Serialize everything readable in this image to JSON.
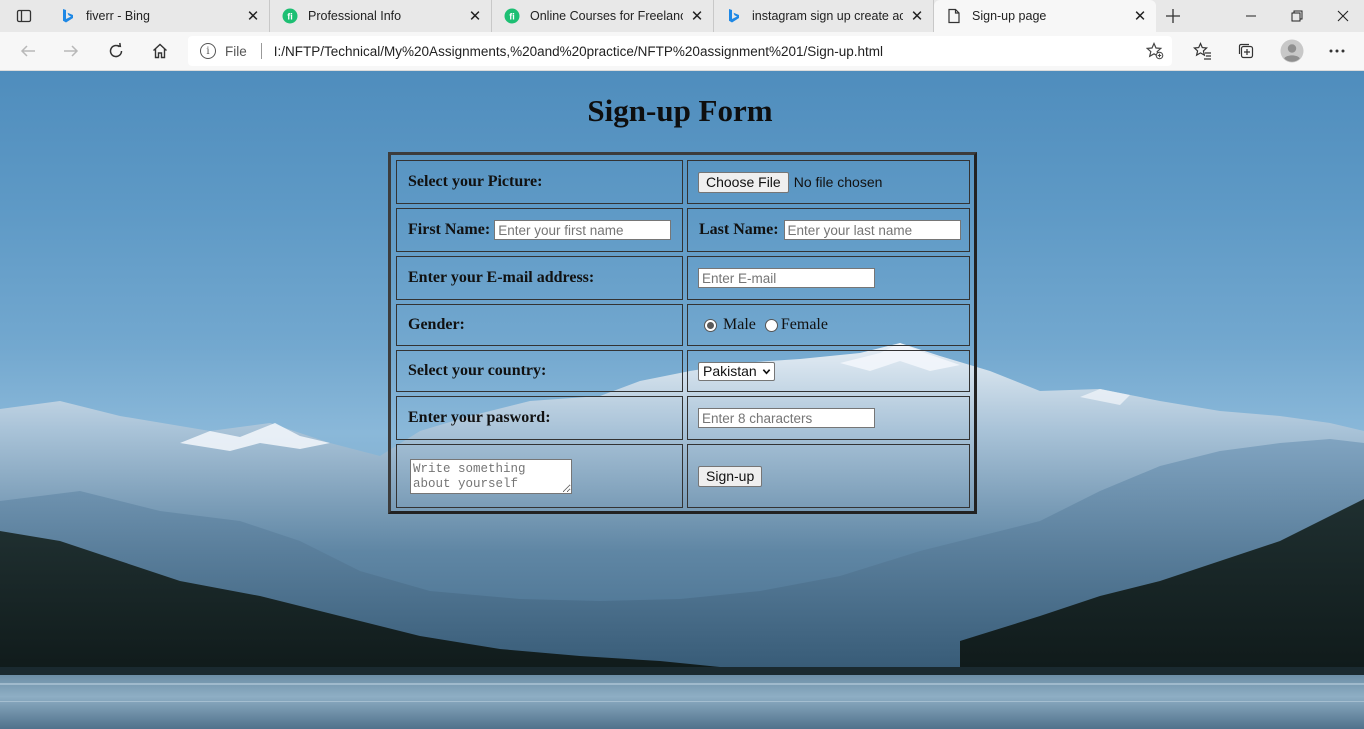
{
  "browser": {
    "tabs": [
      {
        "title": "fiverr - Bing",
        "icon": "bing-icon",
        "active": false
      },
      {
        "title": "Professional Info",
        "icon": "fiverr-learn-icon",
        "active": false
      },
      {
        "title": "Online Courses for Freelancers",
        "icon": "fiverr-learn-icon",
        "active": false
      },
      {
        "title": "instagram sign up create account",
        "icon": "bing-icon",
        "active": false
      },
      {
        "title": "Sign-up page",
        "icon": "page-icon",
        "active": true
      }
    ],
    "address": {
      "scheme_label": "File",
      "url": "I:/NFTP/Technical/My%20Assignments,%20and%20practice/NFTP%20assignment%201/Sign-up.html"
    },
    "colors": {
      "accent": "#1da1f2",
      "fiverr_green": "#1dbf73",
      "bing_blue": "#1e88e5"
    }
  },
  "page": {
    "title": "Sign-up Form",
    "form": {
      "picture_label": "Select your Picture:",
      "choose_file_button": "Choose File",
      "no_file_text": "No file chosen",
      "first_name_label": "First Name:",
      "first_name_placeholder": "Enter your first name",
      "last_name_label": "Last Name:",
      "last_name_placeholder": "Enter your last name",
      "email_label": "Enter your E-mail address:",
      "email_placeholder": "Enter E-mail",
      "gender_label": "Gender:",
      "gender_options": [
        {
          "label": "Male",
          "selected": true
        },
        {
          "label": "Female",
          "selected": false
        }
      ],
      "country_label": "Select your country:",
      "country_selected": "Pakistan",
      "password_label": "Enter your pasword:",
      "password_placeholder": "Enter 8 characters",
      "about_placeholder": "Write something about yourself",
      "submit_button": "Sign-up"
    }
  }
}
